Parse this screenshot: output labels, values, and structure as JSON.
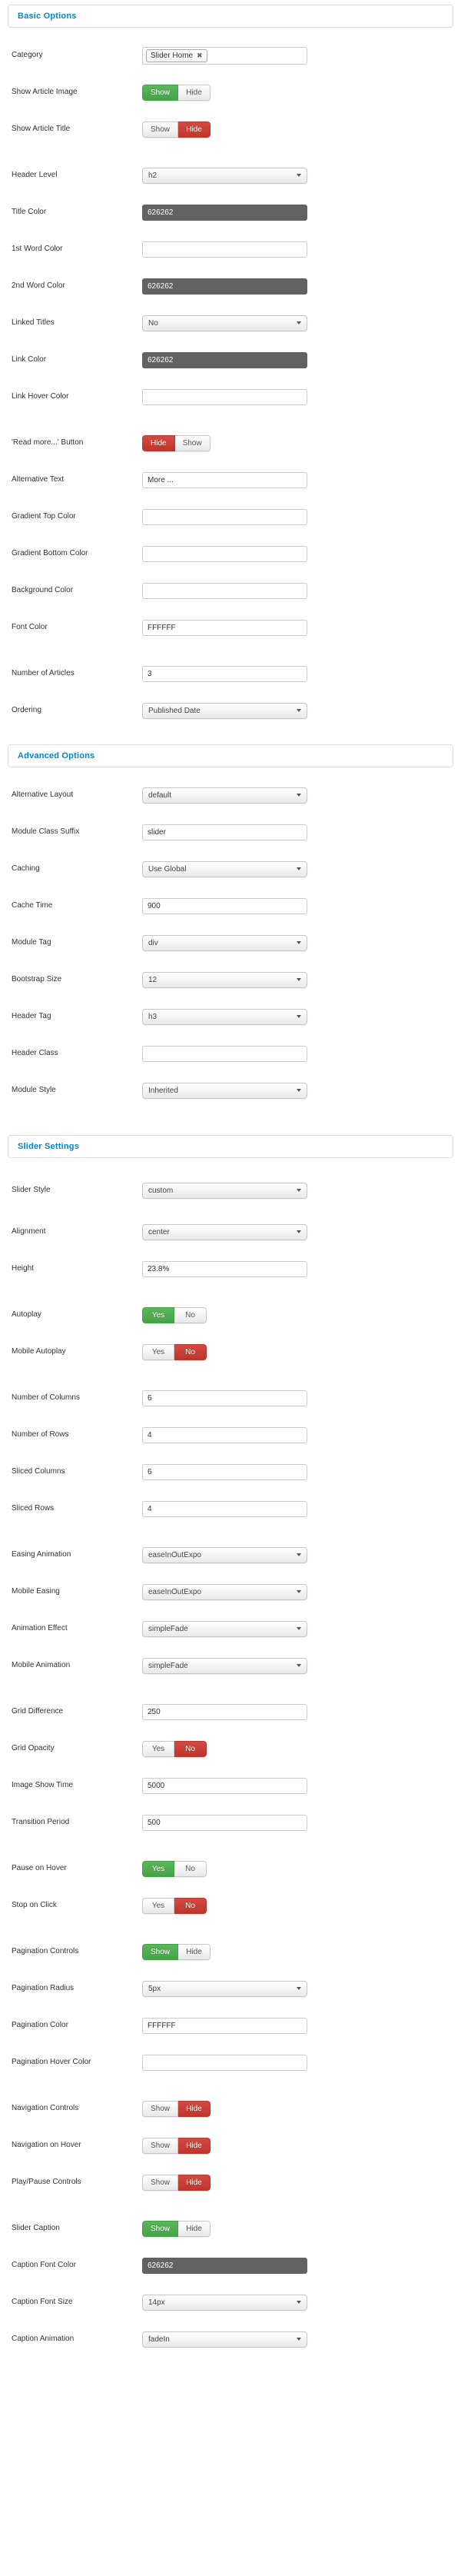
{
  "colors": {
    "accent": "#0088cc",
    "green": "#5bb75b",
    "red": "#c0352c",
    "dark_field": "#626262",
    "text": "#333333"
  },
  "sections": [
    {
      "id": "basic",
      "title": "Basic Options"
    },
    {
      "id": "advanced",
      "title": "Advanced Options"
    },
    {
      "id": "slider",
      "title": "Slider Settings"
    }
  ],
  "basic": {
    "category": {
      "label": "Category",
      "tag": "Slider Home",
      "remove": "✖"
    },
    "show_article_image": {
      "label": "Show Article Image",
      "options": [
        "Show",
        "Hide"
      ],
      "selected": "Show",
      "state": "green"
    },
    "show_article_title": {
      "label": "Show Article Title",
      "options": [
        "Show",
        "Hide"
      ],
      "selected": "Hide",
      "state": "red"
    },
    "header_level": {
      "label": "Header Level",
      "value": "h2"
    },
    "title_color": {
      "label": "Title Color",
      "value": "626262"
    },
    "first_word_color": {
      "label": "1st Word Color",
      "value": ""
    },
    "second_word_color": {
      "label": "2nd Word Color",
      "value": "626262"
    },
    "linked_titles": {
      "label": "Linked Titles",
      "value": "No"
    },
    "link_color": {
      "label": "Link Color",
      "value": "626262"
    },
    "link_hover_color": {
      "label": "Link Hover Color",
      "value": ""
    },
    "read_more_button": {
      "label": "'Read more...' Button",
      "options": [
        "Hide",
        "Show"
      ],
      "selected": "Hide",
      "state": "red"
    },
    "alternative_text": {
      "label": "Alternative Text",
      "value": "More ..."
    },
    "gradient_top_color": {
      "label": "Gradient Top Color",
      "value": ""
    },
    "gradient_bottom_color": {
      "label": "Gradient Bottom Color",
      "value": ""
    },
    "background_color": {
      "label": "Background Color",
      "value": ""
    },
    "font_color": {
      "label": "Font Color",
      "value": "FFFFFF"
    },
    "number_of_articles": {
      "label": "Number of Articles",
      "value": "3"
    },
    "ordering": {
      "label": "Ordering",
      "value": "Published Date"
    }
  },
  "advanced": {
    "alternative_layout": {
      "label": "Alternative Layout",
      "value": "default"
    },
    "module_class_suffix": {
      "label": "Module Class Suffix",
      "value": "slider"
    },
    "caching": {
      "label": "Caching",
      "value": "Use Global"
    },
    "cache_time": {
      "label": "Cache Time",
      "value": "900"
    },
    "module_tag": {
      "label": "Module Tag",
      "value": "div"
    },
    "bootstrap_size": {
      "label": "Bootstrap Size",
      "value": "12"
    },
    "header_tag": {
      "label": "Header Tag",
      "value": "h3"
    },
    "header_class": {
      "label": "Header Class",
      "value": ""
    },
    "module_style": {
      "label": "Module Style",
      "value": "Inherited"
    }
  },
  "slider": {
    "slider_style": {
      "label": "Slider Style",
      "value": "custom"
    },
    "alignment": {
      "label": "Alignment",
      "value": "center"
    },
    "height": {
      "label": "Height",
      "value": "23.8%"
    },
    "autoplay": {
      "label": "Autoplay",
      "options": [
        "Yes",
        "No"
      ],
      "selected": "Yes",
      "state": "green"
    },
    "mobile_autoplay": {
      "label": "Mobile Autoplay",
      "options": [
        "Yes",
        "No"
      ],
      "selected": "No",
      "state": "red"
    },
    "number_of_columns": {
      "label": "Number of Columns",
      "value": "6"
    },
    "number_of_rows": {
      "label": "Number of Rows",
      "value": "4"
    },
    "sliced_columns": {
      "label": "Sliced Columns",
      "value": "6"
    },
    "sliced_rows": {
      "label": "Sliced Rows",
      "value": "4"
    },
    "easing_animation": {
      "label": "Easing Animation",
      "value": "easeInOutExpo"
    },
    "mobile_easing": {
      "label": "Mobile Easing",
      "value": "easeInOutExpo"
    },
    "animation_effect": {
      "label": "Animation Effect",
      "value": "simpleFade"
    },
    "mobile_animation": {
      "label": "Mobile Animation",
      "value": "simpleFade"
    },
    "grid_difference": {
      "label": "Grid Difference",
      "value": "250"
    },
    "grid_opacity": {
      "label": "Grid Opacity",
      "options": [
        "Yes",
        "No"
      ],
      "selected": "No",
      "state": "red"
    },
    "image_show_time": {
      "label": "Image Show Time",
      "value": "5000"
    },
    "transition_period": {
      "label": "Transition Period",
      "value": "500"
    },
    "pause_on_hover": {
      "label": "Pause on Hover",
      "options": [
        "Yes",
        "No"
      ],
      "selected": "Yes",
      "state": "green"
    },
    "stop_on_click": {
      "label": "Stop on Click",
      "options": [
        "Yes",
        "No"
      ],
      "selected": "No",
      "state": "red"
    },
    "pagination_controls": {
      "label": "Pagination Controls",
      "options": [
        "Show",
        "Hide"
      ],
      "selected": "Show",
      "state": "green"
    },
    "pagination_radius": {
      "label": "Pagination Radius",
      "value": "5px"
    },
    "pagination_color": {
      "label": "Pagination Color",
      "value": "FFFFFF"
    },
    "pagination_hover_color": {
      "label": "Pagination Hover Color",
      "value": ""
    },
    "navigation_controls": {
      "label": "Navigation Controls",
      "options": [
        "Show",
        "Hide"
      ],
      "selected": "Hide",
      "state": "red"
    },
    "navigation_on_hover": {
      "label": "Navigation on Hover",
      "options": [
        "Show",
        "Hide"
      ],
      "selected": "Hide",
      "state": "red"
    },
    "play_pause_controls": {
      "label": "Play/Pause Controls",
      "options": [
        "Show",
        "Hide"
      ],
      "selected": "Hide",
      "state": "red"
    },
    "slider_caption": {
      "label": "Slider Caption",
      "options": [
        "Show",
        "Hide"
      ],
      "selected": "Show",
      "state": "green"
    },
    "caption_font_color": {
      "label": "Caption Font Color",
      "value": "626262"
    },
    "caption_font_size": {
      "label": "Caption Font Size",
      "value": "14px"
    },
    "caption_animation": {
      "label": "Caption Animation",
      "value": "fadeIn"
    }
  }
}
